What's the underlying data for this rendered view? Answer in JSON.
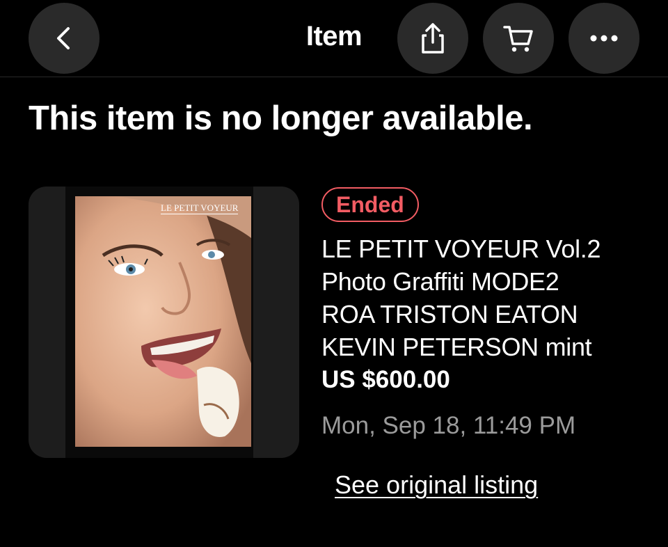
{
  "header": {
    "title": "Item",
    "icons": [
      "back-arrow-icon",
      "share-icon",
      "cart-icon",
      "more-icon"
    ]
  },
  "status_message": "This item is no longer available.",
  "listing": {
    "badge": "Ended",
    "badge_color": "#f25c63",
    "title_lines": [
      "LE PETIT VOYEUR Vol.2",
      "Photo Graffiti MODE2",
      "ROA TRISTON EATON",
      "KEVIN PETERSON mint"
    ],
    "price": "US $600.00",
    "ended_date": "Mon, Sep 18, 11:49 PM",
    "link_text": "See original listing",
    "cover_text": "LE PETIT VOYEUR"
  }
}
